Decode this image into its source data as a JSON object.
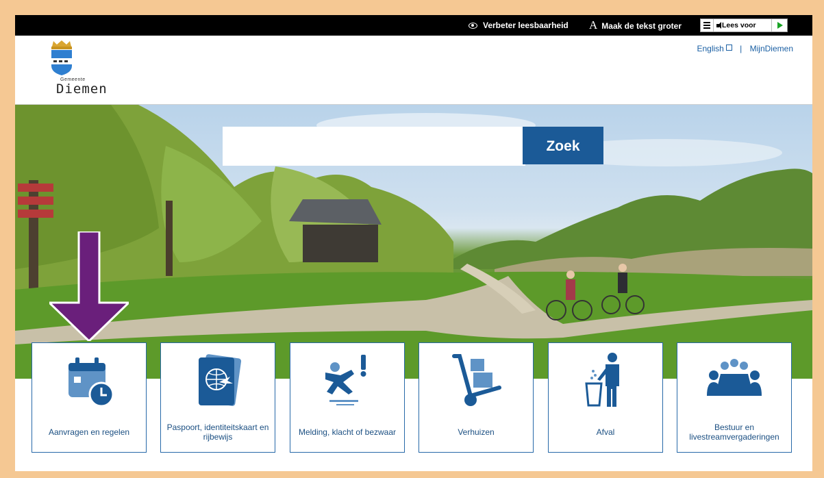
{
  "topbar": {
    "readability": "Verbeter leesbaarheid",
    "bigger_text": "Maak de tekst groter",
    "bigger_text_glyph": "A",
    "read_aloud": "Lees voor"
  },
  "header": {
    "logo_sub": "Gemeente",
    "logo_name": "Diemen",
    "links": [
      "English",
      "MijnDiemen"
    ],
    "separator": "|"
  },
  "search": {
    "placeholder": "",
    "value": "",
    "button_label": "Zoek"
  },
  "tiles": [
    {
      "label": "Aanvragen en regelen",
      "icon": "calendar-clock-icon"
    },
    {
      "label": "Paspoort, identiteitskaart en rijbewijs",
      "icon": "passport-icon"
    },
    {
      "label": "Melding, klacht of bezwaar",
      "icon": "falling-person-icon"
    },
    {
      "label": "Verhuizen",
      "icon": "hand-truck-icon"
    },
    {
      "label": "Afval",
      "icon": "waste-bin-icon"
    },
    {
      "label": "Bestuur en livestreamvergaderingen",
      "icon": "meeting-table-icon"
    }
  ],
  "colors": {
    "accent": "#1b5a97",
    "icon_dark": "#1b5a97",
    "icon_light": "#5f93c6",
    "arrow": "#6a1f7b",
    "frame": "#f5c893",
    "topbar": "#000000"
  }
}
